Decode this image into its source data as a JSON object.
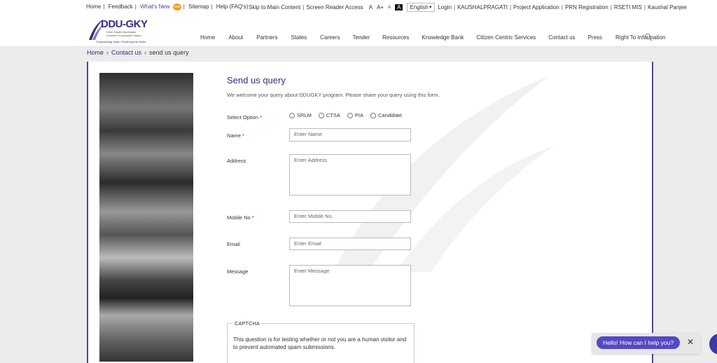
{
  "topbar": {
    "left": [
      "Home",
      "Feedback",
      "What's New",
      "Sitemap",
      "Help (FAQ's)"
    ],
    "new_badge": "new",
    "skip": "Skip to Main Content",
    "reader": "Screen Reader Access",
    "font_a": "A",
    "font_ap": "A+",
    "font_am": "A",
    "font_contrast": "A",
    "language": "English",
    "right": [
      "Login",
      "KAUSHALPRAGATI",
      "Project Application",
      "PRN Registration",
      "RSETI MIS",
      "Kaushal Panjee"
    ]
  },
  "logo": {
    "name": "DDU-GKY",
    "sub": "Deen Dayal Upadhyaya Grameen Kaushalya Yojana",
    "tag": "Empowering India • Powering the World"
  },
  "nav": [
    "Home",
    "About",
    "Partners",
    "States",
    "Careers",
    "Tender",
    "Resources",
    "Knowledge Bank",
    "Citizen Centric Services",
    "Contact us",
    "Press",
    "Right To Information"
  ],
  "breadcrumb": {
    "home": "Home",
    "contact": "Contact us",
    "current": "send us query"
  },
  "form": {
    "title": "Send us query",
    "intro": "We welcome your query about DDUGKY program. Please share your query using this form.",
    "select_label": "Select Option",
    "options": [
      "SRLM",
      "CTSA",
      "PIA",
      "Candidate"
    ],
    "name_label": "Name",
    "name_ph": "Enter Name",
    "address_label": "Address",
    "address_ph": "Enter Address",
    "mobile_label": "Mobile No",
    "mobile_ph": "Enter Mobile No.",
    "email_label": "Email",
    "email_ph": "Enter Email",
    "message_label": "Message",
    "message_ph": "Enter Message",
    "required_mark": "*"
  },
  "captcha": {
    "legend": "CAPTCHA",
    "text": "This question is for testing whether or not you are a human visitor and to prevent automated spam submissions."
  },
  "chat": {
    "prompt": "Hello! How can I help you?",
    "close": "✕"
  },
  "colors": {
    "brand": "#3d2a7d",
    "accent": "#5b3d9c",
    "chat": "#5549c4"
  }
}
